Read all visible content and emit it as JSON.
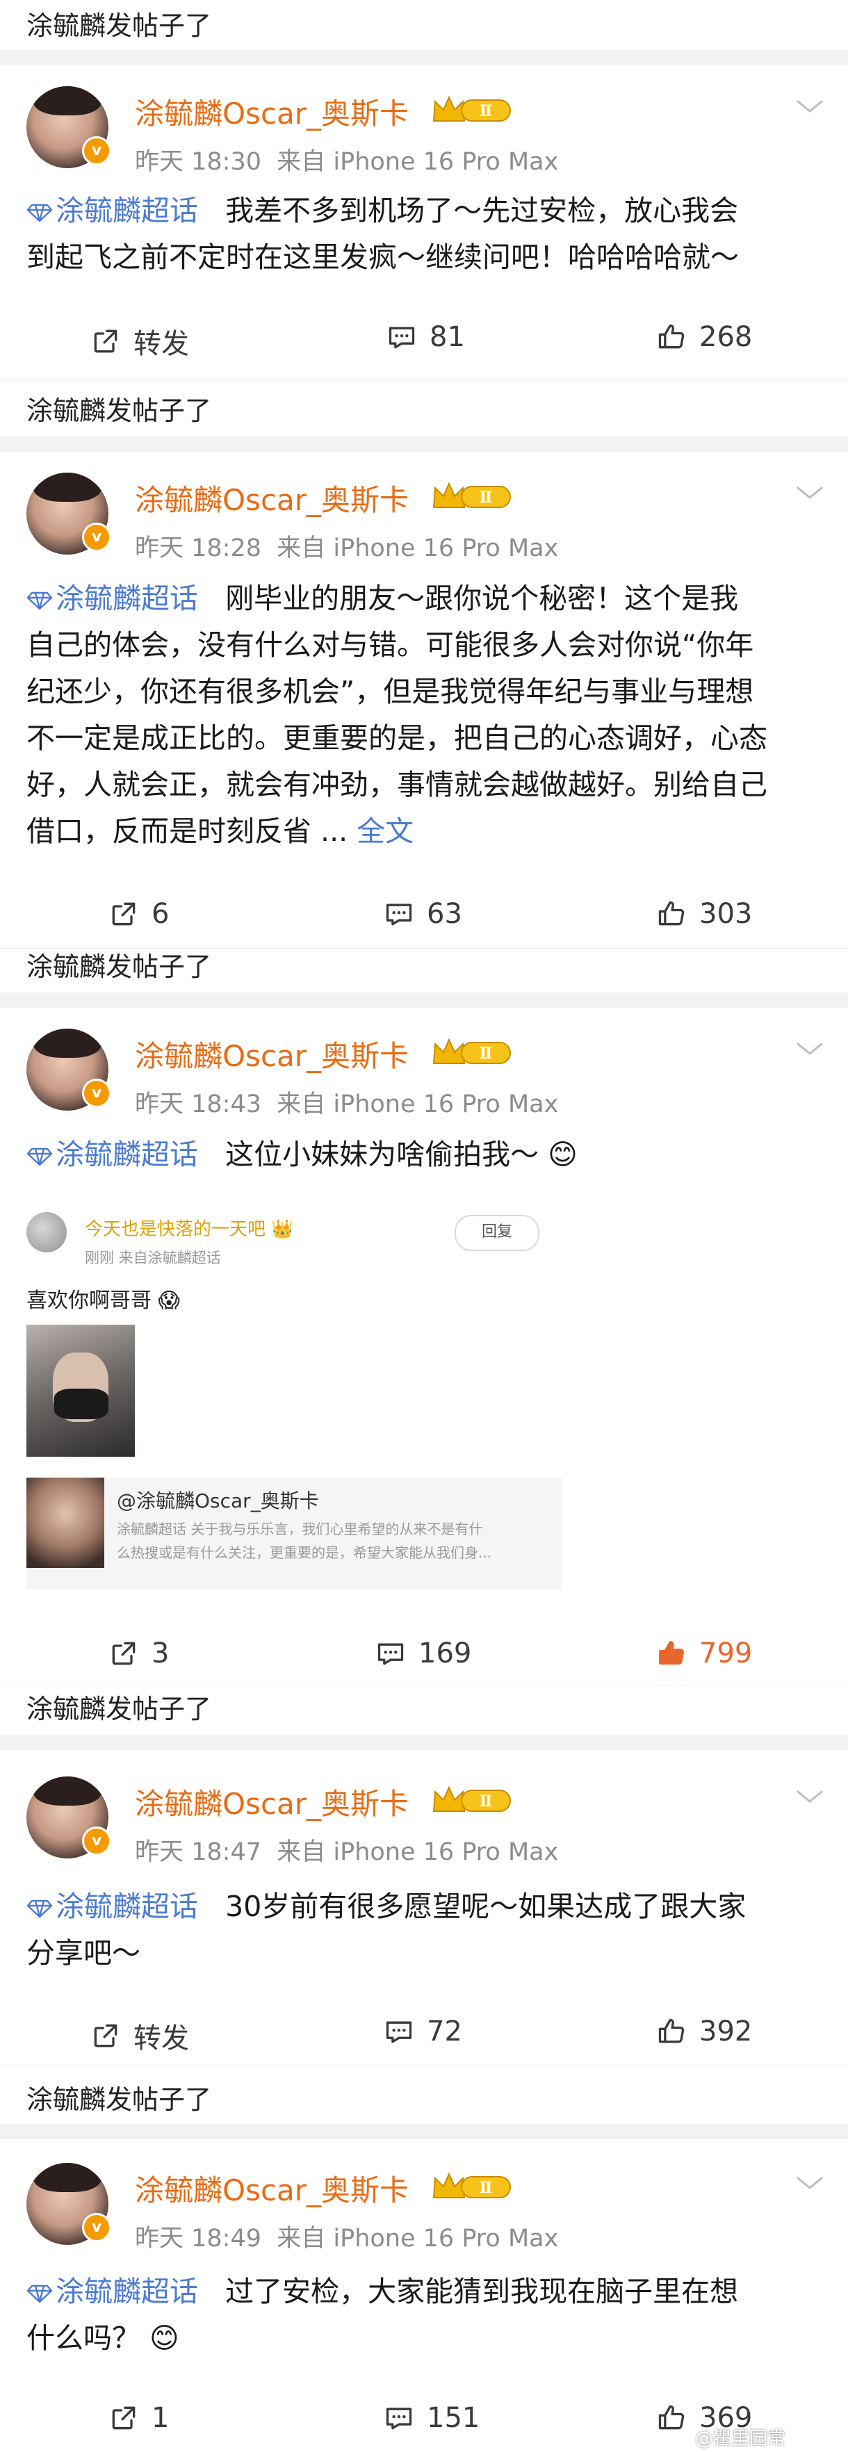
{
  "section_label": "涂毓麟发帖子了",
  "colors": {
    "username": "#e86b13",
    "tag": "#4b7bd1",
    "liked": "#e8652d",
    "badge": "#f59a00"
  },
  "posts": [
    {
      "username": "涂毓麟Oscar_奥斯卡",
      "level": "Ⅱ",
      "time": "昨天 18:30",
      "source": "来自 iPhone 16 Pro Max",
      "tag": "涂毓麟超话",
      "lines": [
        "我差不多到机场了～先过安检，放心我会",
        "到起飞之前不定时在这里发疯～继续问吧！哈哈哈哈就～"
      ],
      "repost": "转发",
      "comments": "81",
      "likes": "268"
    },
    {
      "username": "涂毓麟Oscar_奥斯卡",
      "level": "Ⅱ",
      "time": "昨天 18:28",
      "source": "来自 iPhone 16 Pro Max",
      "tag": "涂毓麟超话",
      "lines": [
        "刚毕业的朋友～跟你说个秘密！这个是我",
        "自己的体会，没有什么对与错。可能很多人会对你说“你年",
        "纪还少，你还有很多机会”，但是我觉得年纪与事业与理想",
        "不一定是成正比的。更重要的是，把自己的心态调好，心态",
        "好，人就会正，就会有冲劲，事情就会越做越好。别给自己",
        "借口，反而是时刻反省"
      ],
      "more": "全文",
      "repost": "6",
      "comments": "63",
      "likes": "303"
    },
    {
      "username": "涂毓麟Oscar_奥斯卡",
      "level": "Ⅱ",
      "time": "昨天 18:43",
      "source": "来自 iPhone 16 Pro Max",
      "tag": "涂毓麟超话",
      "lines": [
        "这位小妹妹为啥偷拍我～"
      ],
      "embedded": {
        "commenter": "今天也是快落的一天吧",
        "commenter_meta": "刚刚 来自涂毓麟超话",
        "reply_button": "回复",
        "comment_text": "喜欢你啊哥哥",
        "quote_title": "@涂毓麟Oscar_奥斯卡",
        "quote_line1": "涂毓麟超话  关于我与乐乐言，我们心里希望的从来不是有什",
        "quote_line2": "么热搜或是有什么关注，更重要的是，希望大家能从我们身..."
      },
      "repost": "3",
      "comments": "169",
      "likes": "799",
      "liked": true
    },
    {
      "username": "涂毓麟Oscar_奥斯卡",
      "level": "Ⅱ",
      "time": "昨天 18:47",
      "source": "来自 iPhone 16 Pro Max",
      "tag": "涂毓麟超话",
      "lines": [
        "30岁前有很多愿望呢～如果达成了跟大家",
        "分享吧～"
      ],
      "repost": "转发",
      "comments": "72",
      "likes": "392"
    },
    {
      "username": "涂毓麟Oscar_奥斯卡",
      "level": "Ⅱ",
      "time": "昨天 18:49",
      "source": "来自 iPhone 16 Pro Max",
      "tag": "涂毓麟超话",
      "lines": [
        "过了安检，大家能猜到我现在脑子里在想",
        "什么吗？"
      ],
      "repost": "1",
      "comments": "151",
      "likes": "369"
    }
  ],
  "watermark": "@瞿里园常"
}
